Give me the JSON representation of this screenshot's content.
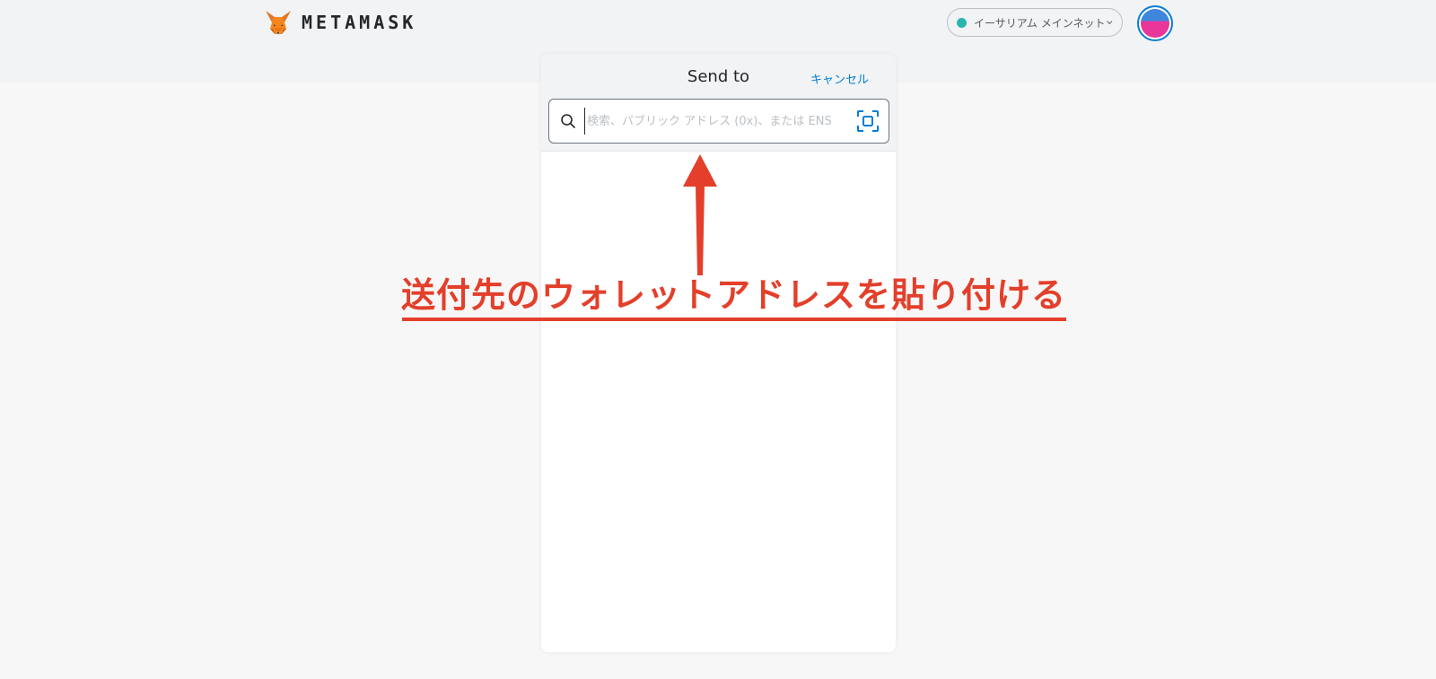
{
  "app": {
    "brand_name": "METAMASK",
    "logo_icon": "metamask-fox-icon"
  },
  "header": {
    "network_label": "イーサリアム メインネット",
    "network_status_color": "#29b6af",
    "chevron_icon": "chevron-down-icon",
    "avatar_colors": [
      "#3f86dc",
      "#e8369a"
    ]
  },
  "send": {
    "title": "Send to",
    "cancel_label": "キャンセル",
    "search_placeholder": "検索、パブリック アドレス (0x)、または ENS",
    "search_value": "",
    "search_icon": "search-icon",
    "qr_icon": "qr-scan-icon"
  },
  "annotation": {
    "text": "送付先のウォレットアドレスを貼り付ける",
    "color": "#e33f2a",
    "arrow_icon": "arrow-up-icon"
  },
  "theme": {
    "accent": "#037dd6"
  }
}
